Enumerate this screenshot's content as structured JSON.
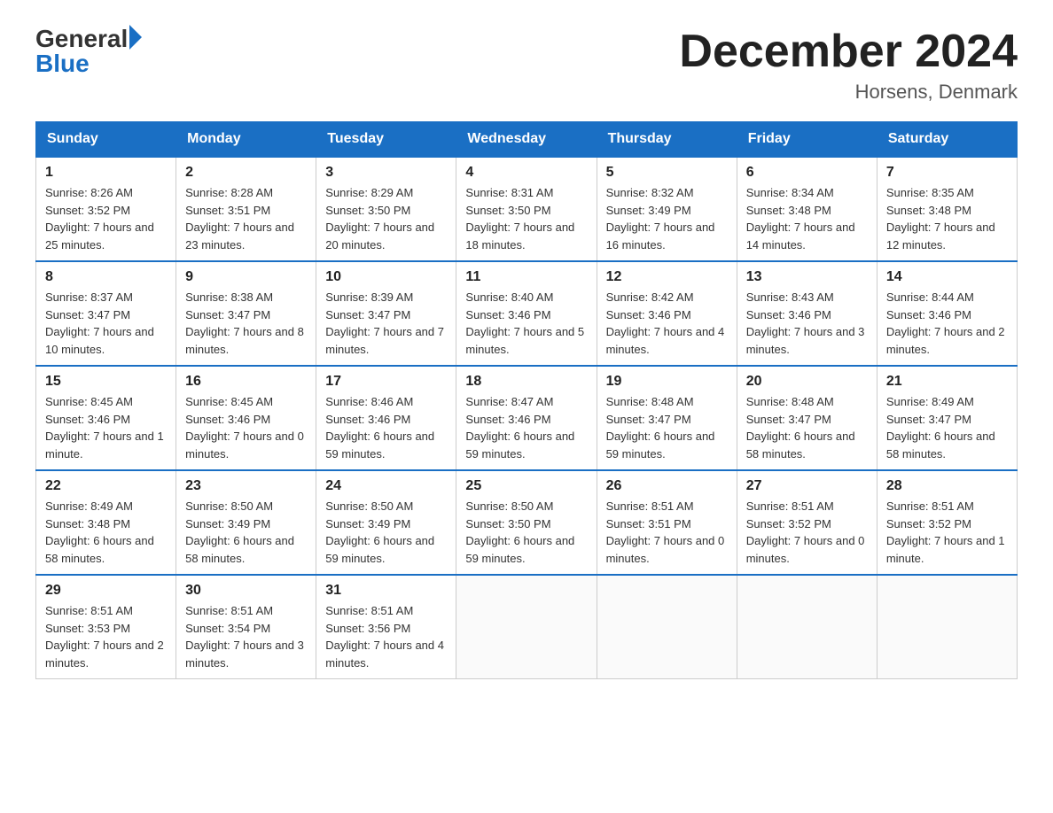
{
  "header": {
    "logo_general": "General",
    "logo_blue": "Blue",
    "title": "December 2024",
    "location": "Horsens, Denmark"
  },
  "days_of_week": [
    "Sunday",
    "Monday",
    "Tuesday",
    "Wednesday",
    "Thursday",
    "Friday",
    "Saturday"
  ],
  "weeks": [
    [
      {
        "day": "1",
        "sunrise": "8:26 AM",
        "sunset": "3:52 PM",
        "daylight": "7 hours and 25 minutes."
      },
      {
        "day": "2",
        "sunrise": "8:28 AM",
        "sunset": "3:51 PM",
        "daylight": "7 hours and 23 minutes."
      },
      {
        "day": "3",
        "sunrise": "8:29 AM",
        "sunset": "3:50 PM",
        "daylight": "7 hours and 20 minutes."
      },
      {
        "day": "4",
        "sunrise": "8:31 AM",
        "sunset": "3:50 PM",
        "daylight": "7 hours and 18 minutes."
      },
      {
        "day": "5",
        "sunrise": "8:32 AM",
        "sunset": "3:49 PM",
        "daylight": "7 hours and 16 minutes."
      },
      {
        "day": "6",
        "sunrise": "8:34 AM",
        "sunset": "3:48 PM",
        "daylight": "7 hours and 14 minutes."
      },
      {
        "day": "7",
        "sunrise": "8:35 AM",
        "sunset": "3:48 PM",
        "daylight": "7 hours and 12 minutes."
      }
    ],
    [
      {
        "day": "8",
        "sunrise": "8:37 AM",
        "sunset": "3:47 PM",
        "daylight": "7 hours and 10 minutes."
      },
      {
        "day": "9",
        "sunrise": "8:38 AM",
        "sunset": "3:47 PM",
        "daylight": "7 hours and 8 minutes."
      },
      {
        "day": "10",
        "sunrise": "8:39 AM",
        "sunset": "3:47 PM",
        "daylight": "7 hours and 7 minutes."
      },
      {
        "day": "11",
        "sunrise": "8:40 AM",
        "sunset": "3:46 PM",
        "daylight": "7 hours and 5 minutes."
      },
      {
        "day": "12",
        "sunrise": "8:42 AM",
        "sunset": "3:46 PM",
        "daylight": "7 hours and 4 minutes."
      },
      {
        "day": "13",
        "sunrise": "8:43 AM",
        "sunset": "3:46 PM",
        "daylight": "7 hours and 3 minutes."
      },
      {
        "day": "14",
        "sunrise": "8:44 AM",
        "sunset": "3:46 PM",
        "daylight": "7 hours and 2 minutes."
      }
    ],
    [
      {
        "day": "15",
        "sunrise": "8:45 AM",
        "sunset": "3:46 PM",
        "daylight": "7 hours and 1 minute."
      },
      {
        "day": "16",
        "sunrise": "8:45 AM",
        "sunset": "3:46 PM",
        "daylight": "7 hours and 0 minutes."
      },
      {
        "day": "17",
        "sunrise": "8:46 AM",
        "sunset": "3:46 PM",
        "daylight": "6 hours and 59 minutes."
      },
      {
        "day": "18",
        "sunrise": "8:47 AM",
        "sunset": "3:46 PM",
        "daylight": "6 hours and 59 minutes."
      },
      {
        "day": "19",
        "sunrise": "8:48 AM",
        "sunset": "3:47 PM",
        "daylight": "6 hours and 59 minutes."
      },
      {
        "day": "20",
        "sunrise": "8:48 AM",
        "sunset": "3:47 PM",
        "daylight": "6 hours and 58 minutes."
      },
      {
        "day": "21",
        "sunrise": "8:49 AM",
        "sunset": "3:47 PM",
        "daylight": "6 hours and 58 minutes."
      }
    ],
    [
      {
        "day": "22",
        "sunrise": "8:49 AM",
        "sunset": "3:48 PM",
        "daylight": "6 hours and 58 minutes."
      },
      {
        "day": "23",
        "sunrise": "8:50 AM",
        "sunset": "3:49 PM",
        "daylight": "6 hours and 58 minutes."
      },
      {
        "day": "24",
        "sunrise": "8:50 AM",
        "sunset": "3:49 PM",
        "daylight": "6 hours and 59 minutes."
      },
      {
        "day": "25",
        "sunrise": "8:50 AM",
        "sunset": "3:50 PM",
        "daylight": "6 hours and 59 minutes."
      },
      {
        "day": "26",
        "sunrise": "8:51 AM",
        "sunset": "3:51 PM",
        "daylight": "7 hours and 0 minutes."
      },
      {
        "day": "27",
        "sunrise": "8:51 AM",
        "sunset": "3:52 PM",
        "daylight": "7 hours and 0 minutes."
      },
      {
        "day": "28",
        "sunrise": "8:51 AM",
        "sunset": "3:52 PM",
        "daylight": "7 hours and 1 minute."
      }
    ],
    [
      {
        "day": "29",
        "sunrise": "8:51 AM",
        "sunset": "3:53 PM",
        "daylight": "7 hours and 2 minutes."
      },
      {
        "day": "30",
        "sunrise": "8:51 AM",
        "sunset": "3:54 PM",
        "daylight": "7 hours and 3 minutes."
      },
      {
        "day": "31",
        "sunrise": "8:51 AM",
        "sunset": "3:56 PM",
        "daylight": "7 hours and 4 minutes."
      },
      null,
      null,
      null,
      null
    ]
  ]
}
